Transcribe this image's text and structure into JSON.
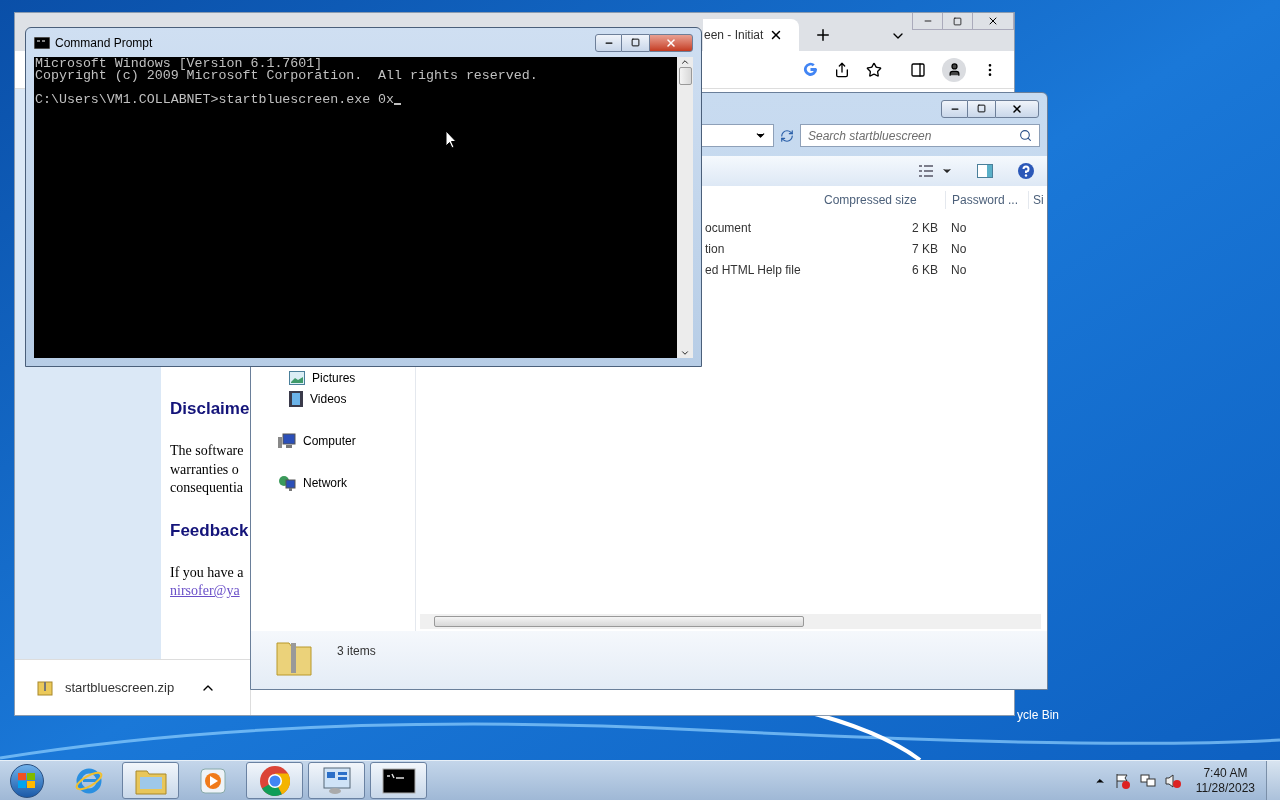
{
  "browser_window": {
    "tab": {
      "title": "een - Initiat"
    },
    "page": {
      "sections": [
        {
          "heading": "Disclaime",
          "lines": [
            "The software",
            "warranties o",
            "consequentia"
          ]
        },
        {
          "heading": "Feedback",
          "lines": [
            "If you have a"
          ],
          "link": "nirsofer@ya"
        }
      ]
    },
    "download": {
      "file": "startbluescreen.zip"
    }
  },
  "explorer_window": {
    "search": {
      "placeholder": "Search startbluescreen"
    },
    "nav_items": [
      {
        "label": "Pictures",
        "kind": "pictures"
      },
      {
        "label": "Videos",
        "kind": "videos"
      },
      {
        "label": "Computer",
        "kind": "computer"
      },
      {
        "label": "Network",
        "kind": "network"
      }
    ],
    "columns": [
      "Compressed size",
      "Password ...",
      "Si"
    ],
    "rows": [
      {
        "name": "ocument",
        "compressed_size": "2 KB",
        "password": "No"
      },
      {
        "name": "tion",
        "compressed_size": "7 KB",
        "password": "No"
      },
      {
        "name": "ed HTML Help file",
        "compressed_size": "6 KB",
        "password": "No"
      }
    ],
    "status": "3 items"
  },
  "cmd_window": {
    "title": "Command Prompt",
    "output": [
      "Microsoft Windows [Version 6.1.7601]",
      "Copyright (c) 2009 Microsoft Corporation.  All rights reserved."
    ],
    "prompt": "C:\\Users\\VM1.COLLABNET>startbluescreen.exe 0x"
  },
  "desktop": {
    "icons": [
      {
        "label": "ycle Bin"
      }
    ]
  },
  "taskbar": {
    "items": [
      {
        "kind": "ie",
        "active": false
      },
      {
        "kind": "explorer",
        "active": true
      },
      {
        "kind": "media",
        "active": false
      },
      {
        "kind": "chrome",
        "active": true
      },
      {
        "kind": "control",
        "active": true
      },
      {
        "kind": "cmd",
        "active": true
      }
    ],
    "clock": {
      "time": "7:40 AM",
      "date": "11/28/2023"
    }
  }
}
